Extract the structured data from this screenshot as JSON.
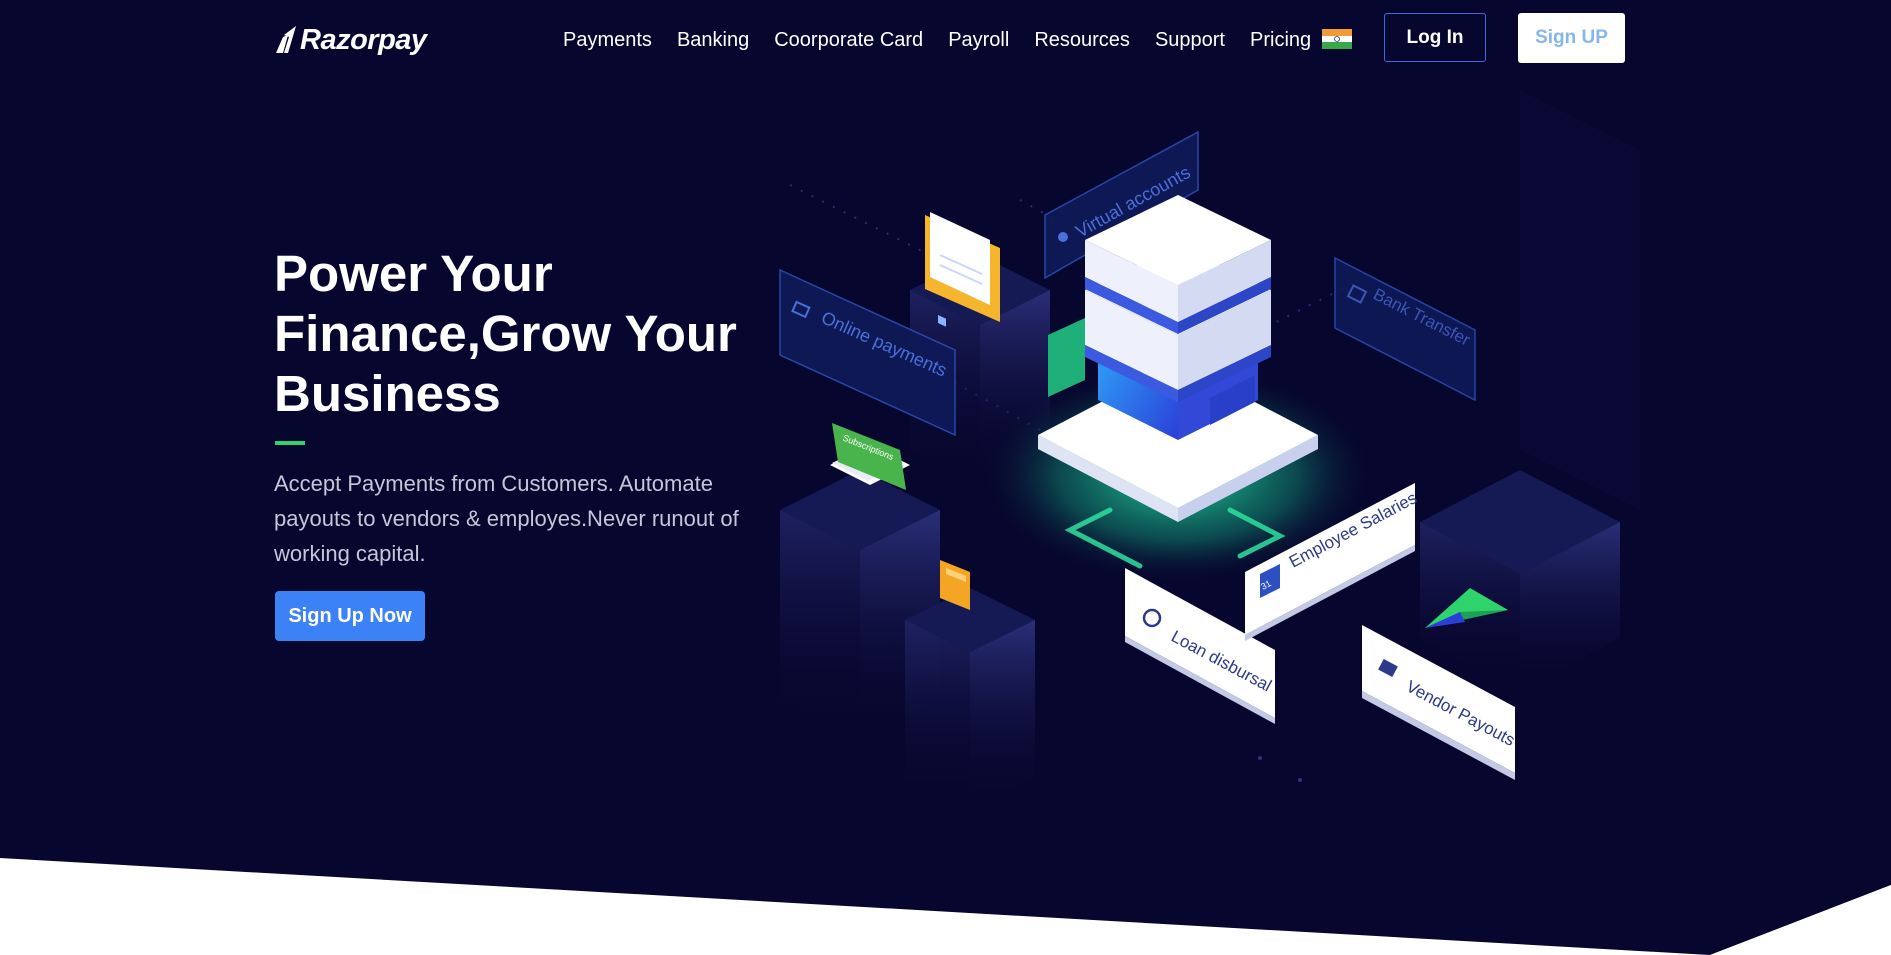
{
  "colors": {
    "background": "#07062e",
    "accent_green": "#2fd36b",
    "cta_blue": "#3c82f6",
    "login_border": "#3d6bd8",
    "signup_text": "#86b7ec"
  },
  "nav": {
    "logo_text": "Razorpay",
    "logo_icon": "razorpay-logo-icon",
    "links": [
      "Payments",
      "Banking",
      "Coorporate Card",
      "Payroll",
      "Resources",
      "Support",
      "Pricing"
    ],
    "flag_icon": "india-flag-icon",
    "login_label": "Log In",
    "signup_label": "Sign UP"
  },
  "hero": {
    "headline_lines": [
      "Power Your",
      "Finance,Grow Your",
      "Business"
    ],
    "subtext": "Accept Payments from Customers. Automate payouts to vendors & employes.Never runout of working capital.",
    "cta_label": "Sign Up Now"
  },
  "illustration": {
    "labels": {
      "virtual_accounts": "Virtual accounts",
      "online_payments": "Online payments",
      "bank_transfer": "Bank Transfer",
      "subscriptions": "Subscriptions",
      "employee_salaries": "Employee Salaries",
      "loan_disbursal": "Loan disbursal",
      "vendor_payouts": "Vendor Payouts",
      "calendar_day": "31"
    }
  }
}
